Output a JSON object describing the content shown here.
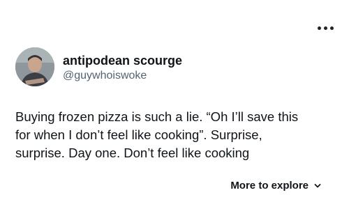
{
  "header": {
    "menu_icon": "more-horizontal-icon"
  },
  "user": {
    "display_name": "antipodean scourge",
    "handle": "@guywhoiswoke",
    "avatar_icon": "avatar-photo"
  },
  "tweet": {
    "lines": [
      "Buying frozen pizza is such a lie. “Oh I’ll save this",
      "for when I don’t feel like cooking”. Surprise,",
      "surprise. Day one. Don’t feel like cooking"
    ]
  },
  "footer": {
    "more_label": "More to explore",
    "chevron_icon": "chevron-down-icon"
  },
  "colors": {
    "text": "#0f1419",
    "secondary": "#536471",
    "background": "#ffffff"
  }
}
